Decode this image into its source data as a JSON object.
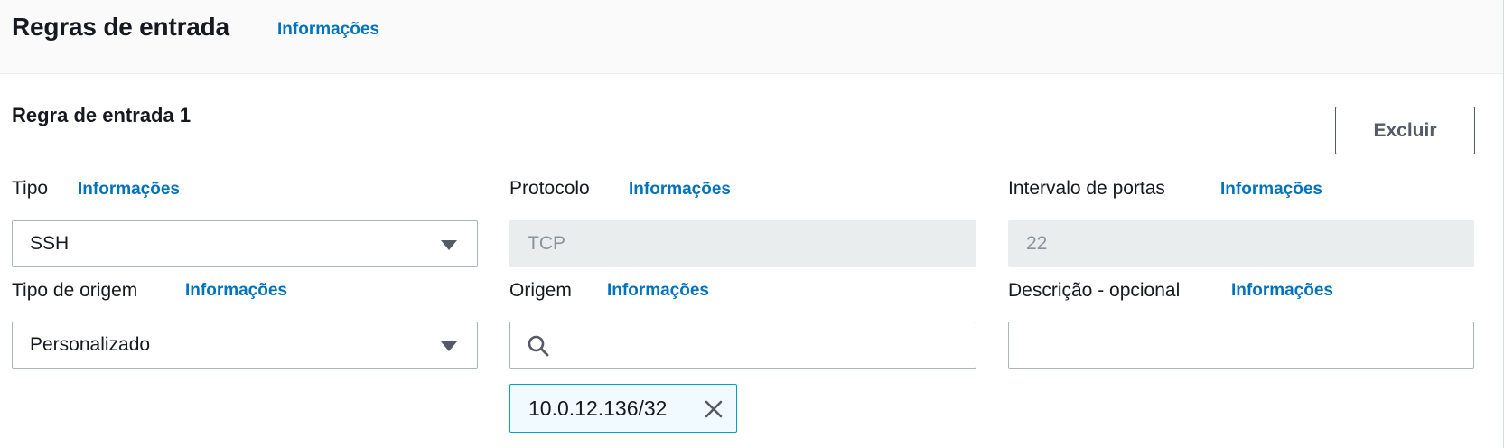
{
  "header": {
    "title": "Regras de entrada",
    "info": "Informações"
  },
  "rule": {
    "title": "Regra de entrada 1",
    "delete_label": "Excluir",
    "tipo": {
      "label": "Tipo",
      "info": "Informações",
      "value": "SSH"
    },
    "protocolo": {
      "label": "Protocolo",
      "info": "Informações",
      "value": "TCP"
    },
    "intervalo": {
      "label": "Intervalo de portas",
      "info": "Informações",
      "value": "22"
    },
    "tipo_origem": {
      "label": "Tipo de origem",
      "info": "Informações",
      "value": "Personalizado"
    },
    "origem": {
      "label": "Origem",
      "info": "Informações",
      "value": "",
      "token": "10.0.12.136/32"
    },
    "descricao": {
      "label": "Descrição - opcional",
      "info": "Informações",
      "value": ""
    }
  },
  "icons": {
    "select": "caret-down-icon",
    "search": "search-icon",
    "remove": "close-icon"
  },
  "colors": {
    "link": "#0073bb",
    "token_border": "#00a1c9",
    "token_bg": "#f1faff",
    "disabled_bg": "#eaeded"
  }
}
